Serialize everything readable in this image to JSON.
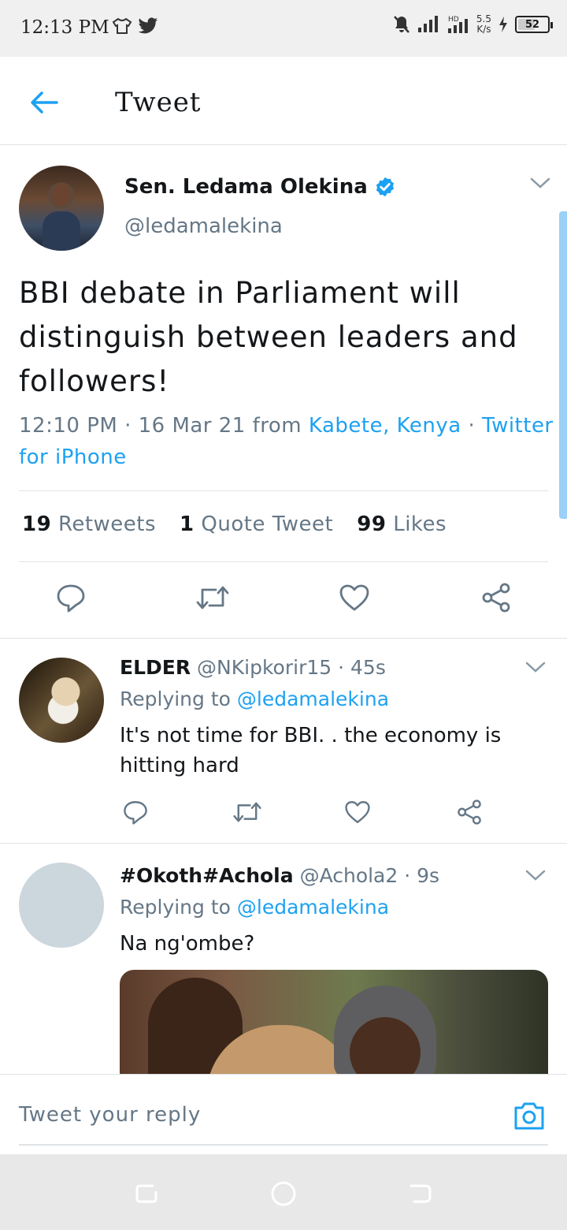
{
  "status_bar": {
    "time": "12:13 PM",
    "speed_value": "5.5",
    "speed_unit": "K/s",
    "battery": "52"
  },
  "header": {
    "title": "Tweet"
  },
  "main_tweet": {
    "name": "Sen. Ledama Olekina",
    "handle": "@ledamalekina",
    "text": "BBI debate in Parliament will distinguish between leaders and followers!",
    "time": "12:10 PM · 16 Mar 21 from ",
    "location": "Kabete, Kenya",
    "separator": " · ",
    "source": "Twitter for iPhone",
    "stats": {
      "retweets_count": "19",
      "retweets_label": "Retweets",
      "quotes_count": "1",
      "quotes_label": "Quote Tweet",
      "likes_count": "99",
      "likes_label": "Likes"
    }
  },
  "replies": [
    {
      "name": "ELDER",
      "handle": "@NKipkorir15",
      "time": "· 45s",
      "replying_prefix": "Replying to",
      "replying_to": "@ledamalekina",
      "text": "It's not time for BBI. . the economy is hitting hard"
    },
    {
      "name": "#Okoth#Achola",
      "handle": "@Achola2",
      "time": "· 9s",
      "replying_prefix": "Replying to",
      "replying_to": "@ledamalekina",
      "text": "Na ng'ombe?"
    }
  ],
  "reply_bar": {
    "placeholder": "Tweet your reply"
  },
  "colors": {
    "accent": "#1da1f2",
    "secondary_text": "#657786",
    "primary_text": "#14171a",
    "divider": "#dfe3e6"
  }
}
